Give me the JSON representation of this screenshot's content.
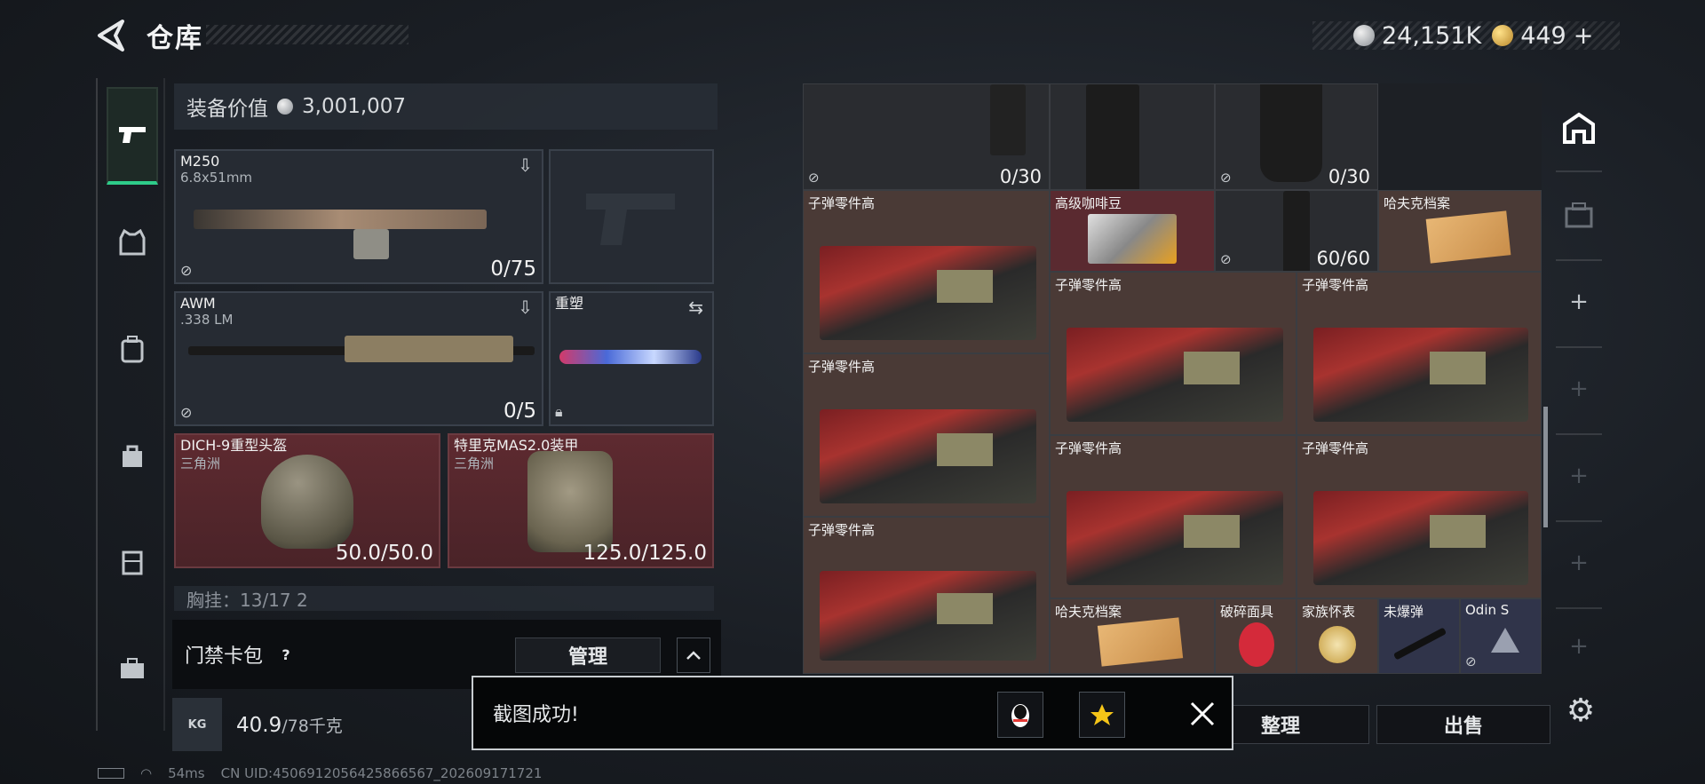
{
  "header": {
    "title": "仓库",
    "silver_amount": "24,151K",
    "gold_amount": "449",
    "gold_plus": "+"
  },
  "sidebar": {
    "items": [
      {
        "icon": "pistol-icon"
      },
      {
        "icon": "armor-vest-icon"
      },
      {
        "icon": "backpack-icon"
      },
      {
        "icon": "bag-icon"
      },
      {
        "icon": "rig-icon"
      },
      {
        "icon": "briefcase-icon"
      }
    ]
  },
  "equipment": {
    "value_label": "装备价值",
    "value": "3,001,007",
    "slots": {
      "primary": {
        "name": "M250",
        "caliber": "6.8x51mm",
        "ammo": "0/75"
      },
      "sidearm": {
        "name": "",
        "ammo": ""
      },
      "secondary": {
        "name": "AWM",
        "caliber": ".338 LM",
        "ammo": "0/5"
      },
      "melee": {
        "name": "重塑"
      },
      "helmet": {
        "name": "DICH-9重型头盔",
        "faction": "三角洲",
        "durability": "50.0/50.0"
      },
      "armor": {
        "name": "特里克MAS2.0装甲",
        "faction": "三角洲",
        "durability": "125.0/125.0"
      }
    },
    "cut_row_text": "胸挂：13/17  2"
  },
  "card_pack": {
    "label": "门禁卡包",
    "help": "?",
    "manage_label": "管理",
    "collapse_icon": "^"
  },
  "weight": {
    "icon_text": "KG",
    "current": "40.9",
    "max": "/78千克"
  },
  "status": {
    "ping": "54ms",
    "uid": "CN UID:4506912056425866567_202609171721"
  },
  "stash": {
    "top_row": [
      {
        "count": "0/30"
      },
      {
        "count": "0/30"
      }
    ],
    "items": {
      "ammo_parts_label": "子弹零件高",
      "coffee": "高级咖啡豆",
      "gun_count": "60/60",
      "hafuk_file": "哈夫克档案",
      "broken_mask": "破碎面具",
      "family_watch": "家族怀表",
      "unexploded": "未爆弹",
      "odin": "Odin S"
    }
  },
  "actions": {
    "sort_label": "整理",
    "sell_label": "出售"
  },
  "toast": {
    "message": "截图成功!",
    "qq_icon": "penguin-icon",
    "star_icon": "star-icon"
  }
}
